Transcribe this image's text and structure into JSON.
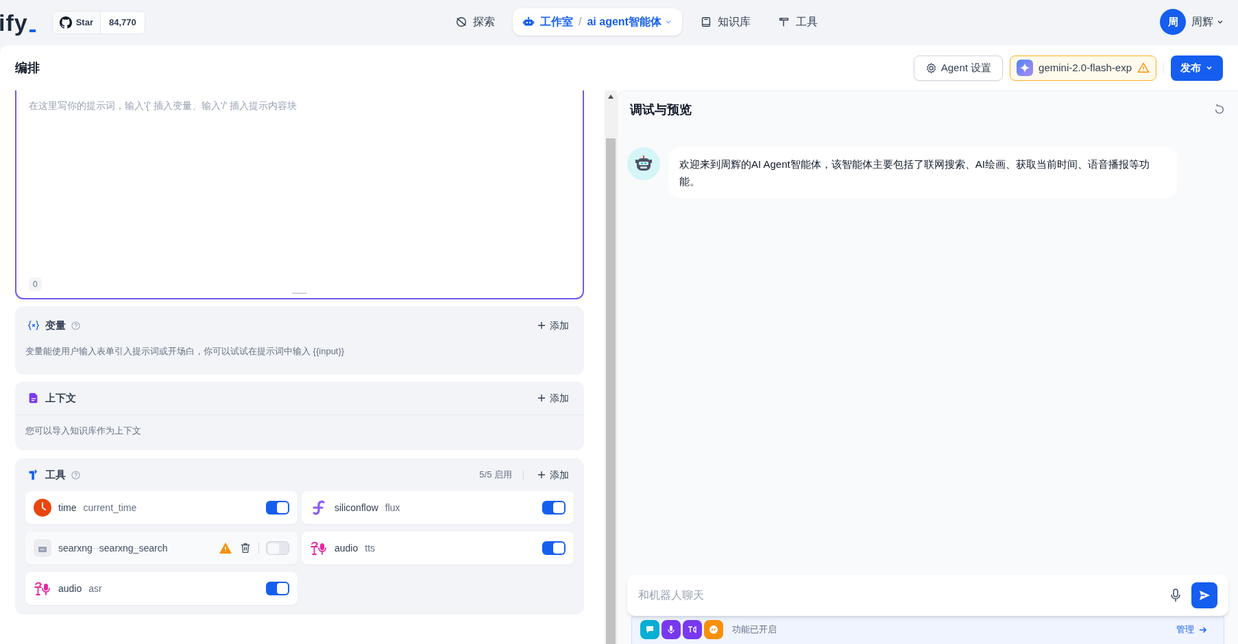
{
  "logo": {
    "text": "ify"
  },
  "github": {
    "label": "Star",
    "count": "84,770"
  },
  "nav": [
    {
      "kind": "explore",
      "label": "探索",
      "selected": false
    },
    {
      "kind": "studio",
      "label": "工作室",
      "separator": "/",
      "app": "ai agent智能体",
      "selected": true
    },
    {
      "kind": "knowledge",
      "label": "知识库",
      "selected": false
    },
    {
      "kind": "tools",
      "label": "工具",
      "selected": false
    }
  ],
  "user": {
    "avatar": "周",
    "name": "周辉"
  },
  "toolbar": {
    "title": "编排",
    "settings_button": "Agent 设置",
    "model": "gemini-2.0-flash-exp",
    "model_warning": true,
    "publish": "发布"
  },
  "prompt": {
    "placeholder": "在这里写你的提示词，输入'{' 插入变量、输入'/' 插入提示内容块",
    "count": "0"
  },
  "variables": {
    "title": "变量",
    "add": "添加",
    "description": "变量能使用户输入表单引入提示词或开场白，你可以试试在提示词中输入 {{input}}"
  },
  "context": {
    "title": "上下文",
    "add": "添加",
    "description": "您可以导入知识库作为上下文"
  },
  "tools": {
    "title": "工具",
    "enabled_count": "5/5 启用",
    "add": "添加",
    "items": [
      {
        "kind": "clock",
        "provider": "time",
        "name": "current_time",
        "on": true,
        "disabled": false
      },
      {
        "kind": "flux",
        "provider": "siliconflow",
        "name": "flux",
        "on": true,
        "disabled": false
      },
      {
        "kind": "search",
        "provider": "searxng",
        "name": "searxng_search",
        "on": false,
        "disabled": true
      },
      {
        "kind": "audio",
        "provider": "audio",
        "name": "tts",
        "on": true,
        "disabled": false
      },
      {
        "kind": "audio",
        "provider": "audio",
        "name": "asr",
        "on": true,
        "disabled": false
      }
    ]
  },
  "preview": {
    "title": "调试与预览",
    "messages": [
      {
        "kind": "bot",
        "text": "欢迎来到周辉的AI Agent智能体，该智能体主要包括了联网搜索、AI绘画、获取当前时间、语音播报等功能。"
      }
    ],
    "input_placeholder": "和机器人聊天",
    "features": {
      "icons": [
        {
          "kind": "chat"
        },
        {
          "kind": "mic"
        },
        {
          "kind": "tts"
        },
        {
          "kind": "quote"
        }
      ],
      "label": "功能已开启",
      "manage": "管理"
    }
  }
}
